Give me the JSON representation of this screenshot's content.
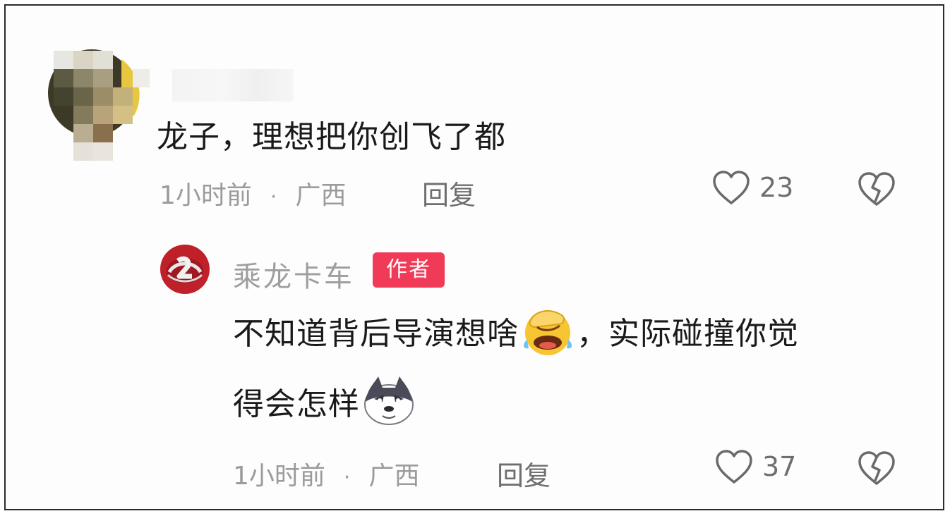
{
  "comment": {
    "text": "龙子，理想把你创飞了都",
    "time": "1小时前",
    "dot": "·",
    "location": "广西",
    "reply_label": "回复",
    "likes": "23"
  },
  "reply": {
    "author": "乘龙卡车",
    "author_badge": "作者",
    "line1_before": "不知道背后导演想啥",
    "line1_after": "，实际碰撞你觉",
    "line2": "得会怎样",
    "time": "1小时前",
    "dot": "·",
    "location": "广西",
    "reply_label": "回复",
    "likes": "37"
  },
  "colors": {
    "badge": "#f03a57",
    "meta_text": "#9b9b9b",
    "body_text": "#1a1a1a"
  },
  "icons": {
    "like": "heart-outline",
    "dislike": "broken-heart-outline",
    "emoji_1": "facepalm-laughing-emoji",
    "emoji_2": "husky-dog-emoji"
  }
}
